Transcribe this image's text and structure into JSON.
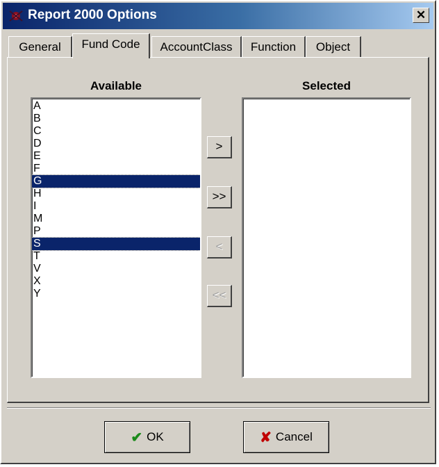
{
  "window": {
    "title": "Report 2000 Options",
    "close_glyph": "✕"
  },
  "tabs": [
    {
      "label": "General",
      "active": false
    },
    {
      "label": "Fund Code",
      "active": true
    },
    {
      "label": "AccountClass",
      "active": false
    },
    {
      "label": "Function",
      "active": false
    },
    {
      "label": "Object",
      "active": false
    }
  ],
  "available": {
    "header": "Available",
    "items": [
      "A",
      "B",
      "C",
      "D",
      "E",
      "F",
      "G",
      "H",
      "I",
      "M",
      "P",
      "S",
      "T",
      "V",
      "X",
      "Y"
    ],
    "selected_items": [
      "G",
      "S"
    ]
  },
  "selected": {
    "header": "Selected",
    "items": []
  },
  "movers": {
    "add": ">",
    "add_all": ">>",
    "remove": "<",
    "remove_all": "<<"
  },
  "buttons": {
    "ok": "OK",
    "cancel": "Cancel"
  },
  "colors": {
    "title_start": "#0a246a",
    "title_end": "#a6caf0",
    "selection": "#0a246a",
    "ok_check": "#1a8a1a",
    "cancel_x": "#c00000"
  },
  "icons": {
    "app": "app-icon",
    "ok": "checkmark-icon",
    "cancel": "x-mark-icon"
  }
}
